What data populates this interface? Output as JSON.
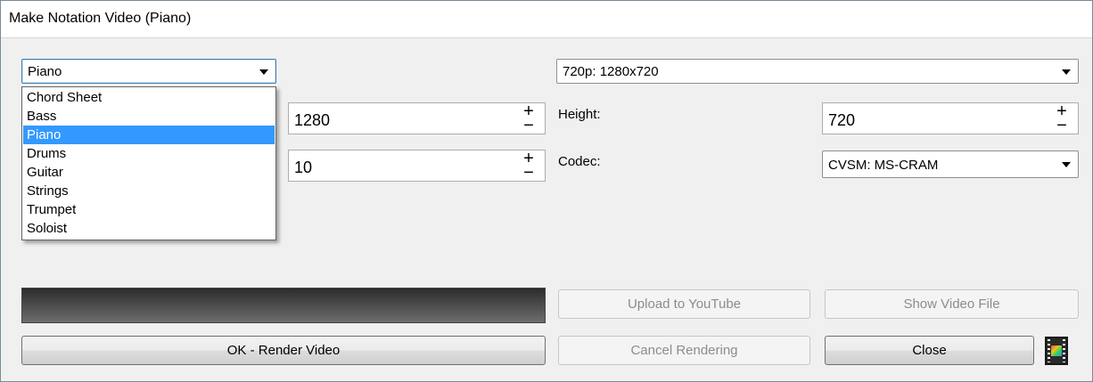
{
  "window": {
    "title": "Make Notation Video (Piano)"
  },
  "track_select": {
    "value": "Piano",
    "options": [
      "Chord Sheet",
      "Bass",
      "Piano",
      "Drums",
      "Guitar",
      "Strings",
      "Trumpet",
      "Soloist"
    ],
    "selected": "Piano"
  },
  "resolution_select": {
    "value": "720p: 1280x720"
  },
  "width_field": {
    "value": "1280"
  },
  "fps_field": {
    "value": "10"
  },
  "height": {
    "label": "Height:",
    "value": "720"
  },
  "codec": {
    "label": "Codec:",
    "value": "CVSM: MS-CRAM"
  },
  "spin": {
    "plus": "+",
    "minus": "−"
  },
  "progress": {
    "fraction": 0
  },
  "buttons": {
    "render": "OK - Render Video",
    "upload": "Upload to YouTube",
    "show_file": "Show Video File",
    "cancel": "Cancel Rendering",
    "close": "Close"
  },
  "icons": {
    "film": "film-strip-icon"
  }
}
